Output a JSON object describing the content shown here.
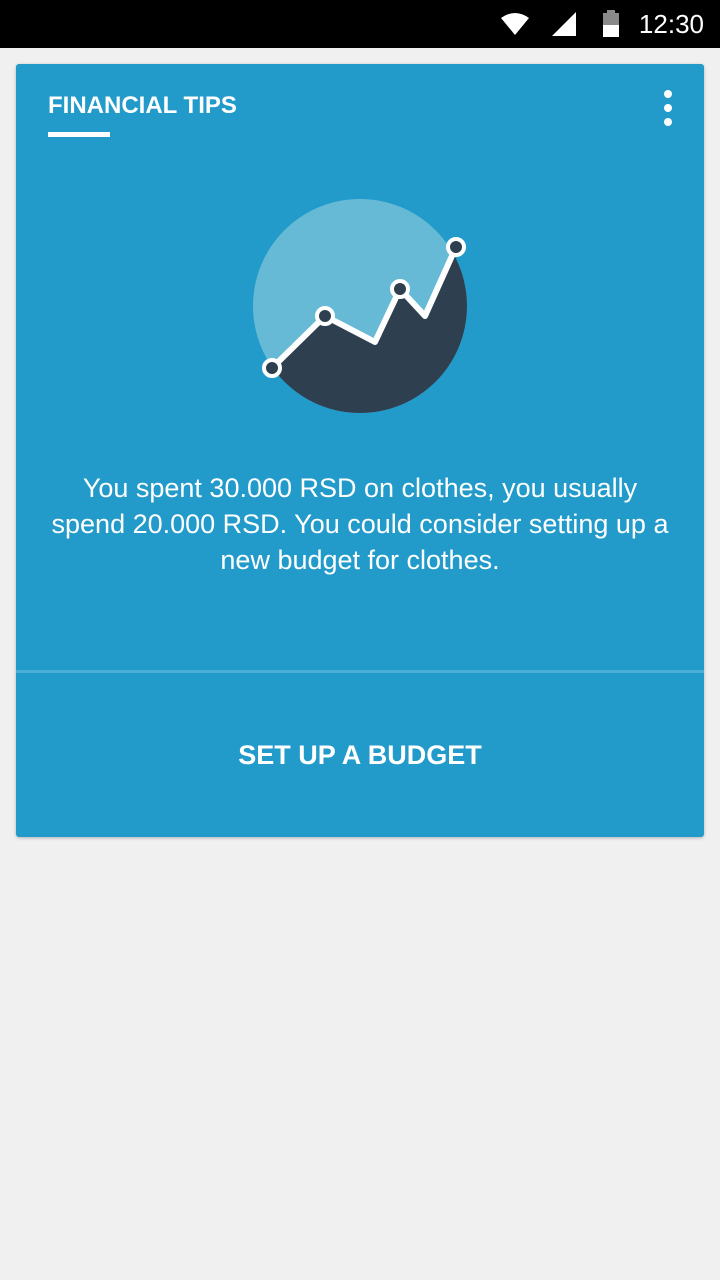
{
  "status_bar": {
    "time": "12:30",
    "icons": [
      "wifi-icon",
      "cell-signal-icon",
      "battery-icon"
    ]
  },
  "card": {
    "title": "FINANCIAL TIPS",
    "menu_icon": "more-vert-icon",
    "illustration_icon": "trend-chart-icon",
    "message": "You spent 30.000 RSD on clothes, you usually spend 20.000 RSD. You could consider setting up a new budget for clothes.",
    "action_label": "SET UP A BUDGET"
  },
  "colors": {
    "card_background": "#229bca",
    "page_background": "#f0f0f0",
    "status_bar": "#000000",
    "illustration_light": "#66bad6",
    "illustration_dark": "#2e3f50"
  }
}
